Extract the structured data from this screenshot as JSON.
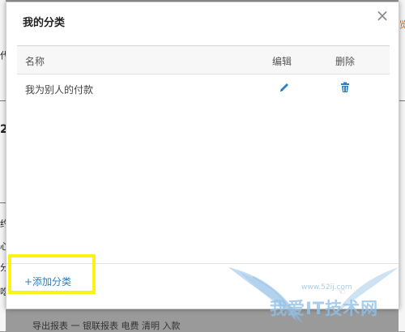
{
  "dialog": {
    "title": "我的分类",
    "close_glyph": "×"
  },
  "table": {
    "headers": {
      "name": "名称",
      "edit": "编辑",
      "delete": "删除"
    },
    "rows": [
      {
        "name": "我为别人的付款",
        "edit_icon": "pencil-icon",
        "delete_icon": "trash-icon"
      }
    ]
  },
  "footer": {
    "add_label": "+添加分类"
  },
  "background": {
    "left_glyphs": [
      "代",
      "2",
      "约",
      "心",
      "分",
      "吃"
    ],
    "right_glyph": "览",
    "bottom_text": "导出报表    一 银联报表    电费    清明    入款"
  },
  "watermark": {
    "text": "我爱IT技术网",
    "url": "www.52ij.com"
  },
  "colors": {
    "accent": "#2f7fc1",
    "highlight": "#fbf314",
    "watermark": "#91c0e6"
  }
}
